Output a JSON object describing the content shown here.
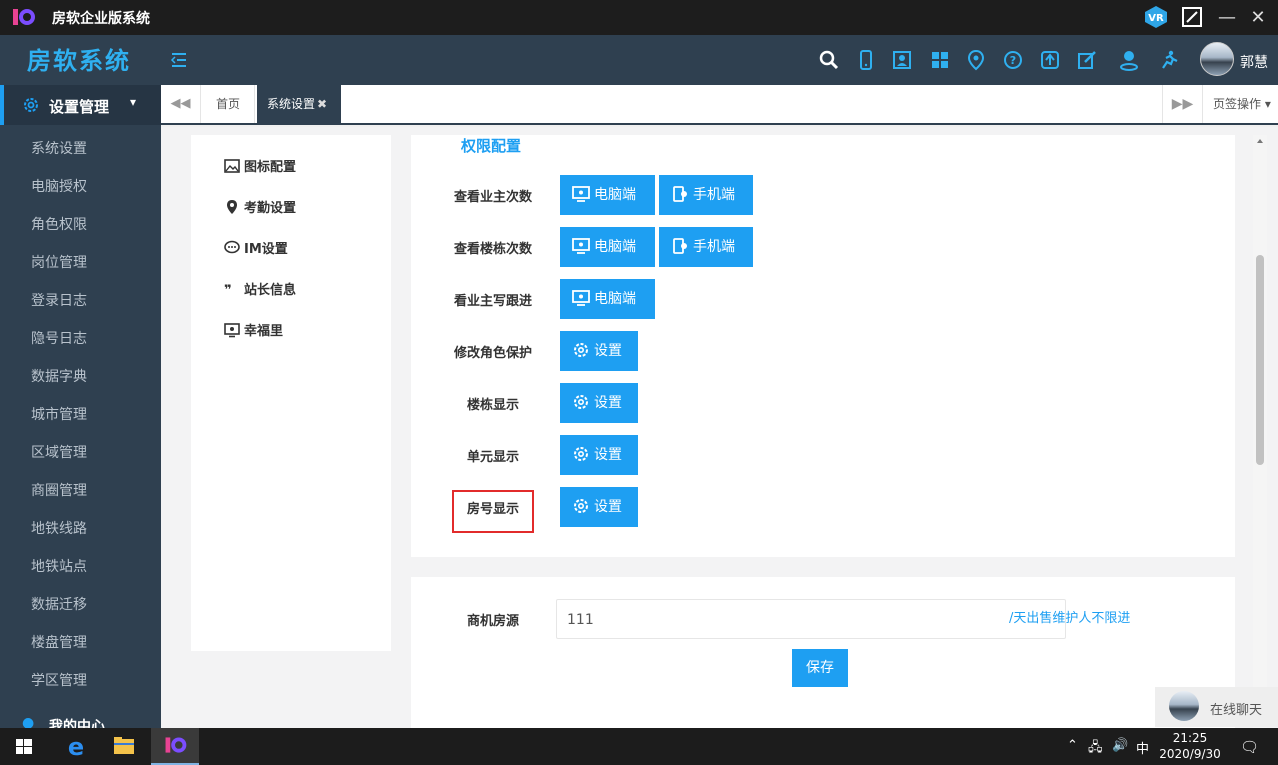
{
  "window": {
    "title": "房软企业版系统"
  },
  "header": {
    "brand": "房软系统",
    "username": "郭慧"
  },
  "sidebar": {
    "section": "设置管理",
    "items": [
      "系统设置",
      "电脑授权",
      "角色权限",
      "岗位管理",
      "登录日志",
      "隐号日志",
      "数据字典",
      "城市管理",
      "区域管理",
      "商圈管理",
      "地铁线路",
      "地铁站点",
      "数据迁移",
      "楼盘管理",
      "学区管理"
    ],
    "footer": "我的中心"
  },
  "tabs": {
    "home": "首页",
    "active": "系统设置",
    "close": "✖",
    "ops": "页签操作"
  },
  "left_menu": [
    "图标配置",
    "考勤设置",
    "IM设置",
    "站长信息",
    "幸福里"
  ],
  "permissions": {
    "title": "权限配置",
    "rows": [
      {
        "label": "查看业主次数",
        "buttons": [
          "电脑端",
          "手机端"
        ]
      },
      {
        "label": "查看楼栋次数",
        "buttons": [
          "电脑端",
          "手机端"
        ]
      },
      {
        "label": "看业主写跟进",
        "buttons": [
          "电脑端"
        ]
      },
      {
        "label": "修改角色保护",
        "buttons": [
          "设置"
        ]
      },
      {
        "label": "楼栋显示",
        "buttons": [
          "设置"
        ]
      },
      {
        "label": "单元显示",
        "buttons": [
          "设置"
        ]
      },
      {
        "label": "房号显示",
        "buttons": [
          "设置"
        ]
      }
    ]
  },
  "commercial": {
    "label": "商机房源",
    "value": "111",
    "hint": "/天出售维护人不限进",
    "save": "保存"
  },
  "chat": {
    "label": "在线聊天"
  },
  "taskbar": {
    "ime": "中",
    "time": "21:25",
    "date": "2020/9/30"
  }
}
